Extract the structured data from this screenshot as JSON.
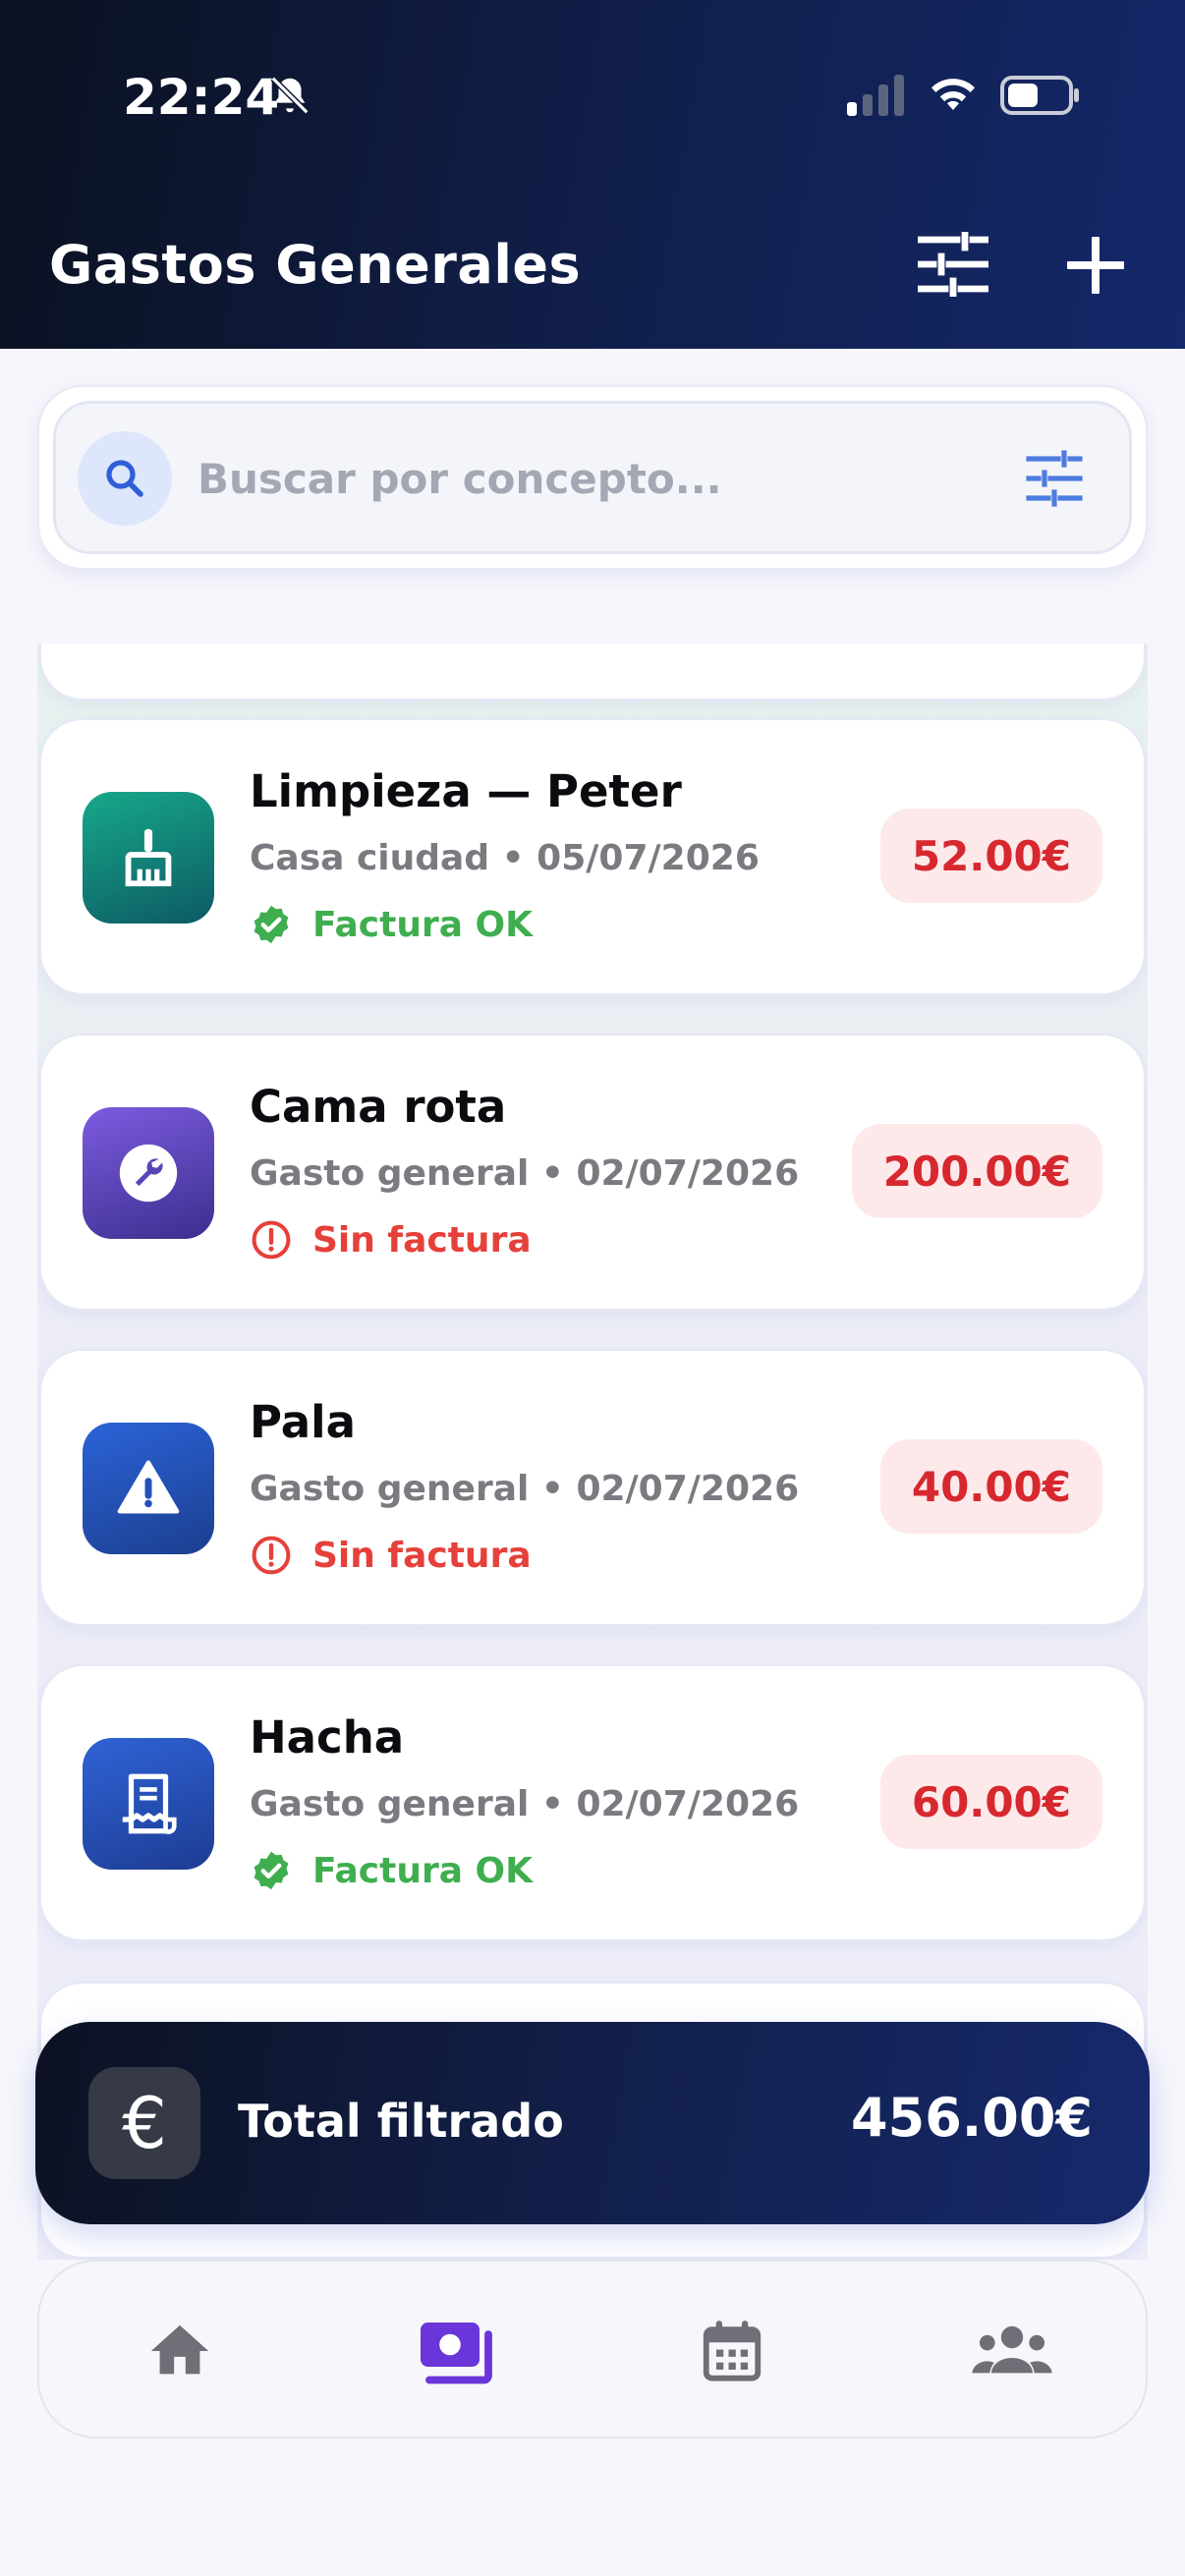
{
  "status_bar": {
    "time": "22:24",
    "icons": [
      "bell-off-icon",
      "signal-icon",
      "wifi-icon",
      "battery-icon"
    ]
  },
  "header": {
    "title": "Gastos Generales",
    "icons": [
      "filter-icon",
      "add-icon"
    ]
  },
  "search": {
    "placeholder": "Buscar por concepto...",
    "value": "",
    "icons": [
      "search-icon",
      "tune-icon"
    ]
  },
  "expenses": [
    {
      "title": "Limpieza — Peter",
      "subtitle": "Casa ciudad • 05/07/2026",
      "status": "Factura OK",
      "status_type": "ok",
      "amount": "52.00€",
      "icon": "broom-icon"
    },
    {
      "title": "Cama rota",
      "subtitle": "Gasto general • 02/07/2026",
      "status": "Sin factura",
      "status_type": "missing",
      "amount": "200.00€",
      "icon": "wrench-icon"
    },
    {
      "title": "Pala",
      "subtitle": "Gasto general • 02/07/2026",
      "status": "Sin factura",
      "status_type": "missing",
      "amount": "40.00€",
      "icon": "warning-icon"
    },
    {
      "title": "Hacha",
      "subtitle": "Gasto general • 02/07/2026",
      "status": "Factura OK",
      "status_type": "ok",
      "amount": "60.00€",
      "icon": "receipt-icon"
    }
  ],
  "total": {
    "symbol": "€",
    "label": "Total filtrado",
    "value": "456.00€"
  },
  "nav": {
    "items": [
      "home-icon",
      "expenses-icon",
      "calendar-icon",
      "people-icon"
    ],
    "active": "expenses-icon"
  },
  "colors": {
    "header_gradient": [
      "#0b1120",
      "#14286a"
    ],
    "accent_purple": "#6a36d9",
    "ok_green": "#3fae4f",
    "missing_red": "#e5403a",
    "amount_red": "#d7282f",
    "amount_bg": "#fde9ea"
  }
}
